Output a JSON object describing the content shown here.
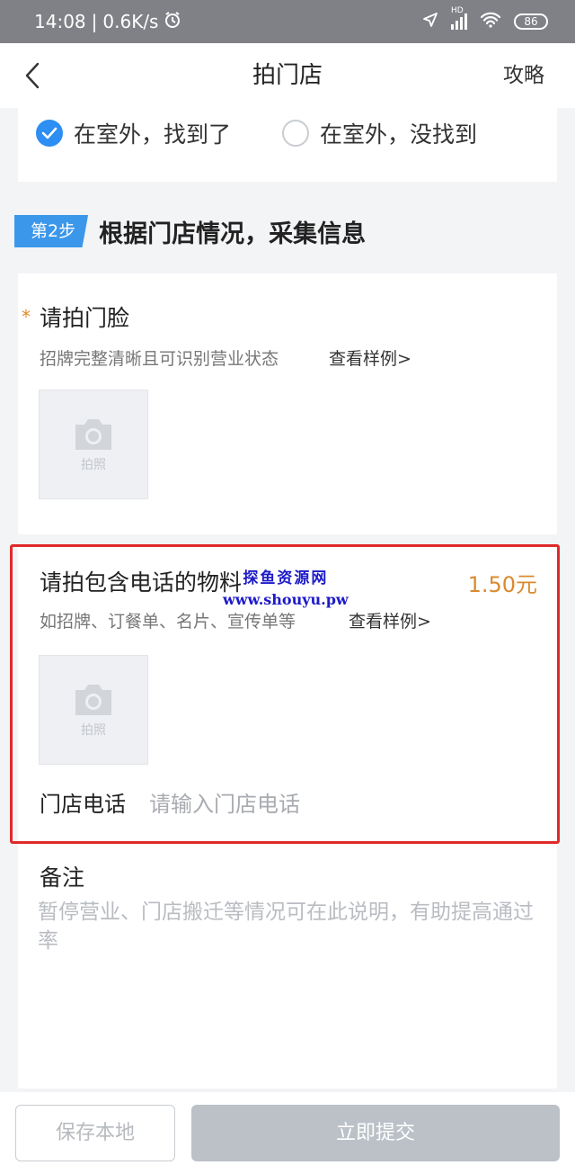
{
  "status_bar": {
    "time": "14:08",
    "speed": "0.6K/s",
    "network": "HD",
    "battery": "86"
  },
  "nav": {
    "title": "拍门店",
    "guide": "攻略"
  },
  "location_options": [
    {
      "label": "在室外，找到了",
      "checked": true
    },
    {
      "label": "在室外，没找到",
      "checked": false
    }
  ],
  "step": {
    "badge": "第2步",
    "title": "根据门店情况，采集信息"
  },
  "storefront": {
    "title": "请拍门脸",
    "required_mark": "*",
    "desc": "招牌完整清晰且可识别营业状态",
    "example": "查看样例>",
    "photo_label": "拍照"
  },
  "phone_material": {
    "title": "请拍包含电话的物料",
    "reward": "1.50元",
    "desc": "如招牌、订餐单、名片、宣传单等",
    "example": "查看样例>",
    "photo_label": "拍照",
    "phone_label": "门店电话",
    "phone_placeholder": "请输入门店电话"
  },
  "watermark": {
    "title": "探鱼资源网",
    "url": "www.shouyu.pw"
  },
  "remark": {
    "title": "备注",
    "placeholder": "暂停营业、门店搬迁等情况可在此说明，有助提高通过率"
  },
  "bottom": {
    "save": "保存本地",
    "submit": "立即提交"
  },
  "colors": {
    "accent": "#2d8ef3",
    "reward": "#d98b2e",
    "highlight": "#e02a2a"
  }
}
